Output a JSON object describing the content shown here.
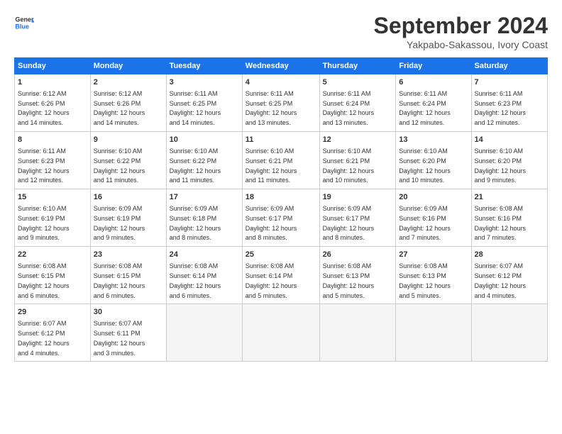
{
  "logo": {
    "line1": "General",
    "line2": "Blue"
  },
  "title": "September 2024",
  "subtitle": "Yakpabo-Sakassou, Ivory Coast",
  "headers": [
    "Sunday",
    "Monday",
    "Tuesday",
    "Wednesday",
    "Thursday",
    "Friday",
    "Saturday"
  ],
  "weeks": [
    [
      {
        "day": "1",
        "rise": "6:12 AM",
        "set": "6:26 PM",
        "daylight": "12 hours and 14 minutes."
      },
      {
        "day": "2",
        "rise": "6:12 AM",
        "set": "6:26 PM",
        "daylight": "12 hours and 14 minutes."
      },
      {
        "day": "3",
        "rise": "6:11 AM",
        "set": "6:25 PM",
        "daylight": "12 hours and 14 minutes."
      },
      {
        "day": "4",
        "rise": "6:11 AM",
        "set": "6:25 PM",
        "daylight": "12 hours and 13 minutes."
      },
      {
        "day": "5",
        "rise": "6:11 AM",
        "set": "6:24 PM",
        "daylight": "12 hours and 13 minutes."
      },
      {
        "day": "6",
        "rise": "6:11 AM",
        "set": "6:24 PM",
        "daylight": "12 hours and 12 minutes."
      },
      {
        "day": "7",
        "rise": "6:11 AM",
        "set": "6:23 PM",
        "daylight": "12 hours and 12 minutes."
      }
    ],
    [
      {
        "day": "8",
        "rise": "6:11 AM",
        "set": "6:23 PM",
        "daylight": "12 hours and 12 minutes."
      },
      {
        "day": "9",
        "rise": "6:10 AM",
        "set": "6:22 PM",
        "daylight": "12 hours and 11 minutes."
      },
      {
        "day": "10",
        "rise": "6:10 AM",
        "set": "6:22 PM",
        "daylight": "12 hours and 11 minutes."
      },
      {
        "day": "11",
        "rise": "6:10 AM",
        "set": "6:21 PM",
        "daylight": "12 hours and 11 minutes."
      },
      {
        "day": "12",
        "rise": "6:10 AM",
        "set": "6:21 PM",
        "daylight": "12 hours and 10 minutes."
      },
      {
        "day": "13",
        "rise": "6:10 AM",
        "set": "6:20 PM",
        "daylight": "12 hours and 10 minutes."
      },
      {
        "day": "14",
        "rise": "6:10 AM",
        "set": "6:20 PM",
        "daylight": "12 hours and 9 minutes."
      }
    ],
    [
      {
        "day": "15",
        "rise": "6:10 AM",
        "set": "6:19 PM",
        "daylight": "12 hours and 9 minutes."
      },
      {
        "day": "16",
        "rise": "6:09 AM",
        "set": "6:19 PM",
        "daylight": "12 hours and 9 minutes."
      },
      {
        "day": "17",
        "rise": "6:09 AM",
        "set": "6:18 PM",
        "daylight": "12 hours and 8 minutes."
      },
      {
        "day": "18",
        "rise": "6:09 AM",
        "set": "6:17 PM",
        "daylight": "12 hours and 8 minutes."
      },
      {
        "day": "19",
        "rise": "6:09 AM",
        "set": "6:17 PM",
        "daylight": "12 hours and 8 minutes."
      },
      {
        "day": "20",
        "rise": "6:09 AM",
        "set": "6:16 PM",
        "daylight": "12 hours and 7 minutes."
      },
      {
        "day": "21",
        "rise": "6:08 AM",
        "set": "6:16 PM",
        "daylight": "12 hours and 7 minutes."
      }
    ],
    [
      {
        "day": "22",
        "rise": "6:08 AM",
        "set": "6:15 PM",
        "daylight": "12 hours and 6 minutes."
      },
      {
        "day": "23",
        "rise": "6:08 AM",
        "set": "6:15 PM",
        "daylight": "12 hours and 6 minutes."
      },
      {
        "day": "24",
        "rise": "6:08 AM",
        "set": "6:14 PM",
        "daylight": "12 hours and 6 minutes."
      },
      {
        "day": "25",
        "rise": "6:08 AM",
        "set": "6:14 PM",
        "daylight": "12 hours and 5 minutes."
      },
      {
        "day": "26",
        "rise": "6:08 AM",
        "set": "6:13 PM",
        "daylight": "12 hours and 5 minutes."
      },
      {
        "day": "27",
        "rise": "6:08 AM",
        "set": "6:13 PM",
        "daylight": "12 hours and 5 minutes."
      },
      {
        "day": "28",
        "rise": "6:07 AM",
        "set": "6:12 PM",
        "daylight": "12 hours and 4 minutes."
      }
    ],
    [
      {
        "day": "29",
        "rise": "6:07 AM",
        "set": "6:12 PM",
        "daylight": "12 hours and 4 minutes."
      },
      {
        "day": "30",
        "rise": "6:07 AM",
        "set": "6:11 PM",
        "daylight": "12 hours and 3 minutes."
      },
      null,
      null,
      null,
      null,
      null
    ]
  ],
  "labels": {
    "sunrise": "Sunrise:",
    "sunset": "Sunset:",
    "daylight": "Daylight:"
  }
}
